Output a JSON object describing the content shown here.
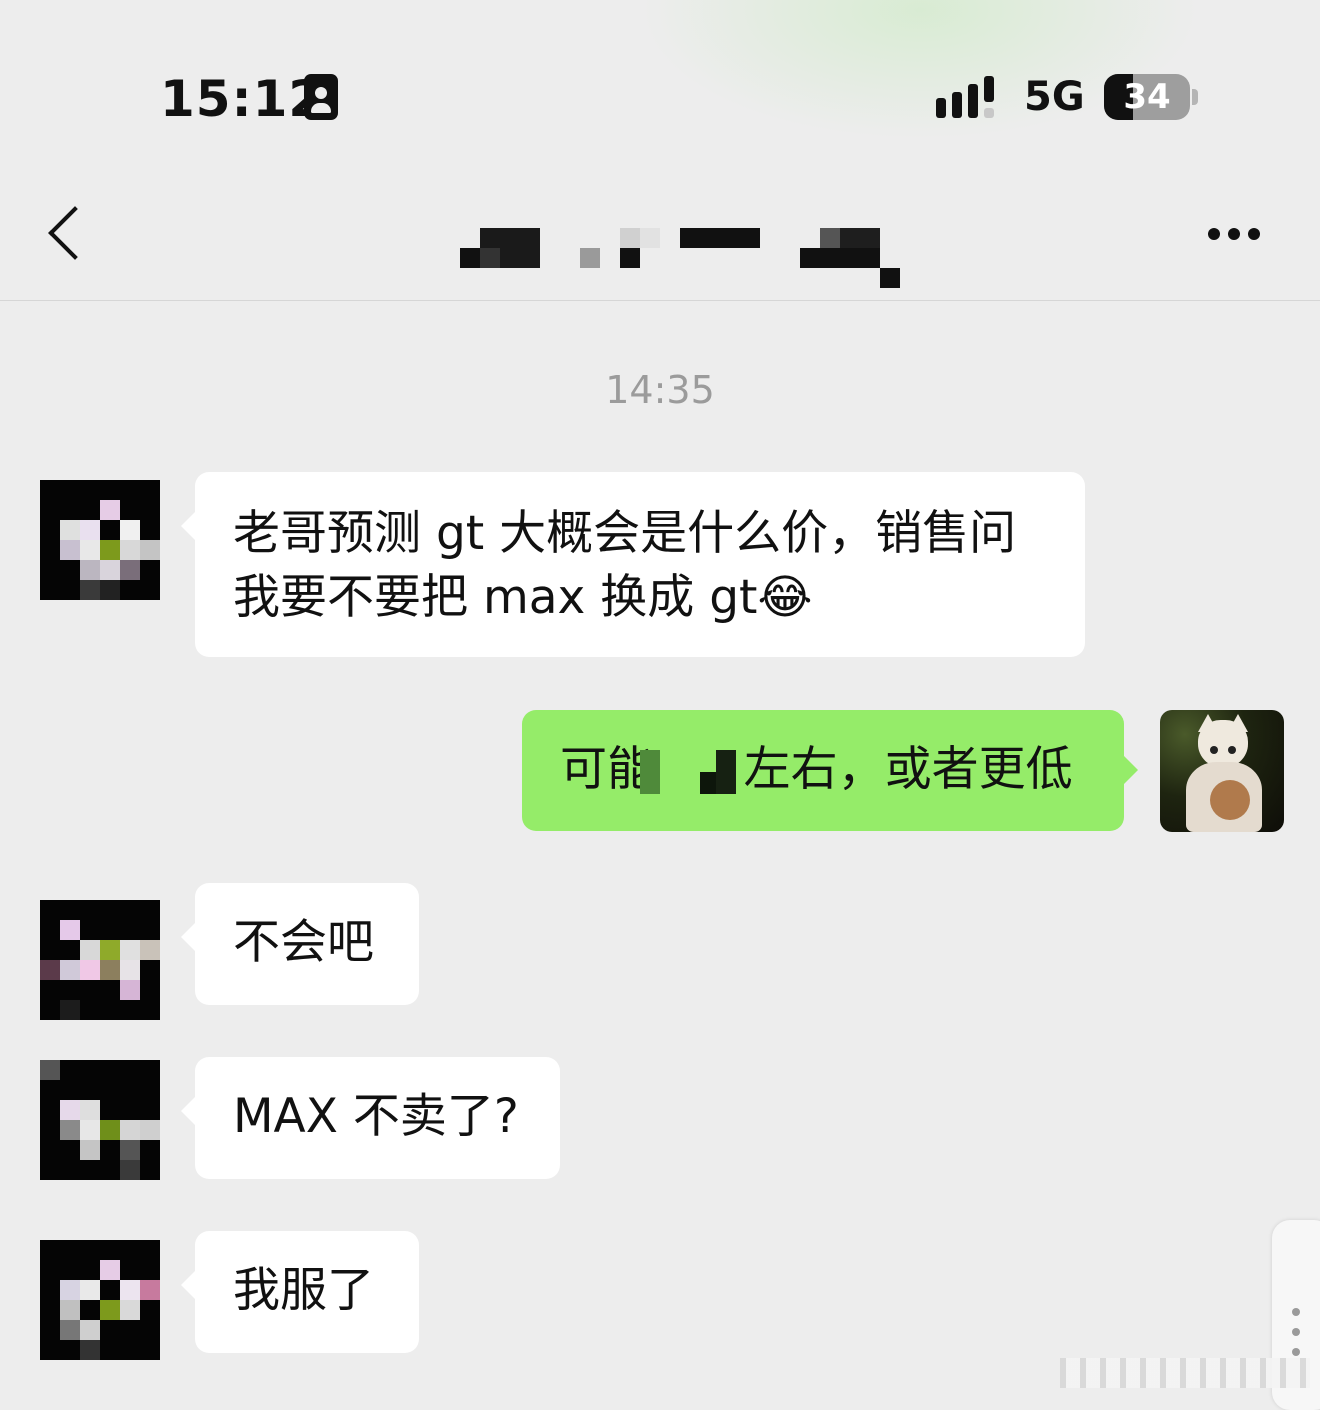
{
  "status_bar": {
    "time": "15:12",
    "network": "5G",
    "battery": "34",
    "battery_level": 0.34
  },
  "nav": {
    "back_icon": "chevron-left-icon",
    "title": "",
    "more_icon": "ellipsis-icon"
  },
  "chat": {
    "timestamp": "14:35",
    "messages": [
      {
        "side": "left",
        "lines": [
          "老哥预测 gt 大概会是什么价，销售问",
          "我要不要把 max 换成 gt😂"
        ]
      },
      {
        "side": "right",
        "text": "可能      左右，或者更低"
      },
      {
        "side": "left",
        "text": "不会吧"
      },
      {
        "side": "left",
        "text": "MAX 不卖了?"
      },
      {
        "side": "left",
        "text": "我服了"
      }
    ]
  }
}
